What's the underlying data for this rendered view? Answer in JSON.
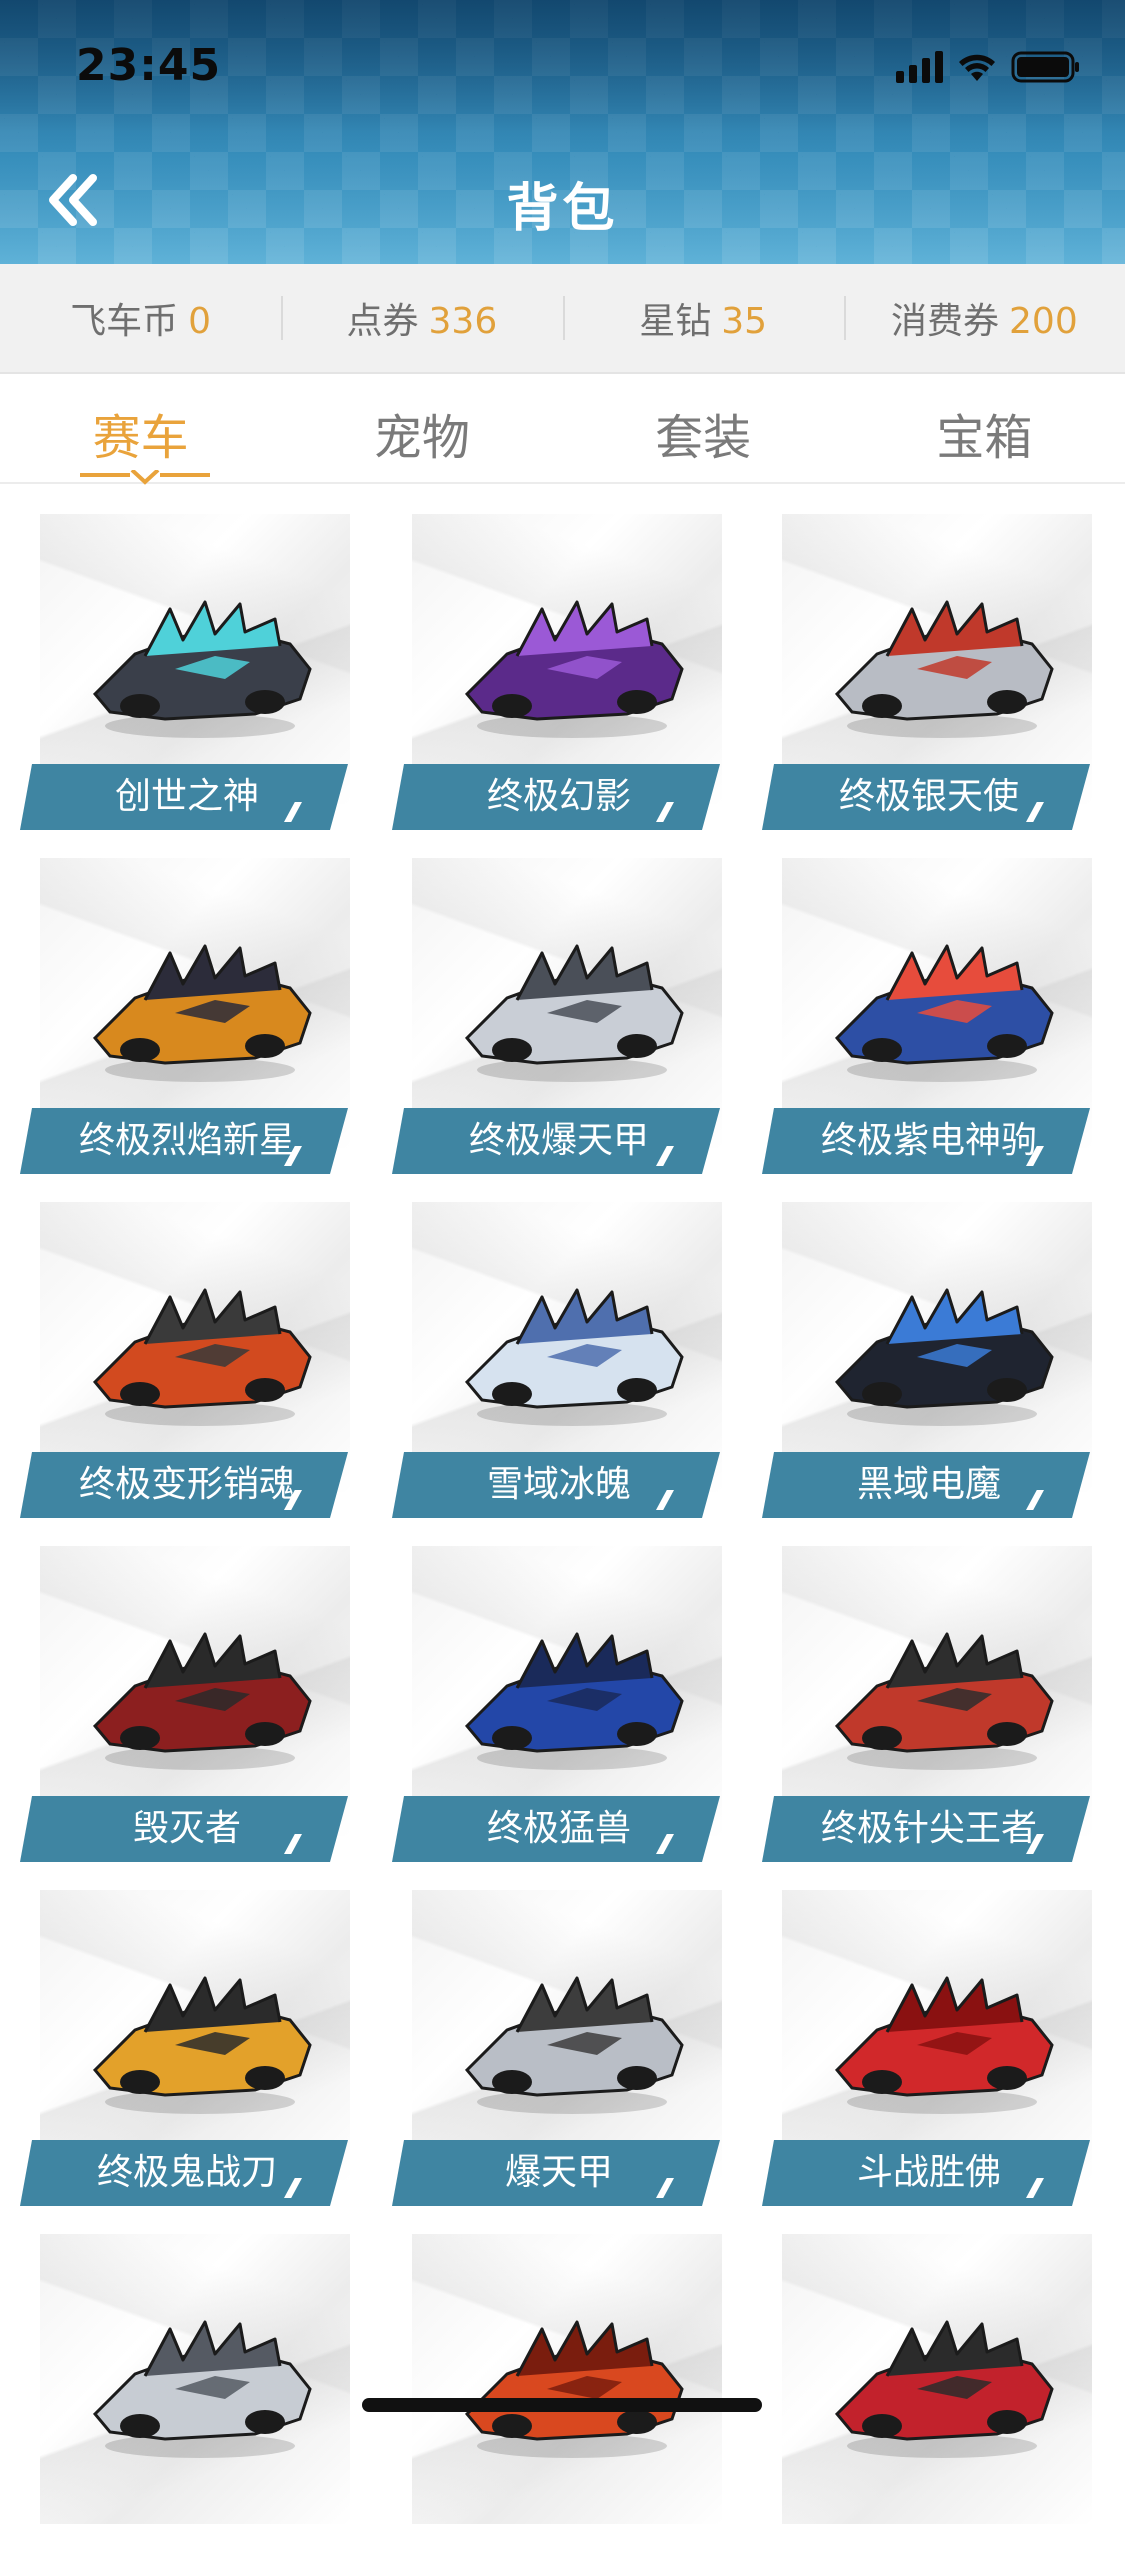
{
  "status_bar": {
    "time": "23:45"
  },
  "header": {
    "title": "背包",
    "back_icon": "double-chevron-left-icon"
  },
  "currencies": [
    {
      "label": "飞车币",
      "value": "0"
    },
    {
      "label": "点券",
      "value": "336"
    },
    {
      "label": "星钻",
      "value": "35"
    },
    {
      "label": "消费券",
      "value": "200"
    }
  ],
  "tabs": [
    {
      "label": "赛车",
      "active": true
    },
    {
      "label": "宠物",
      "active": false
    },
    {
      "label": "套装",
      "active": false
    },
    {
      "label": "宝箱",
      "active": false
    }
  ],
  "colors": {
    "accent": "#e9a33b",
    "label_bg": "#3f85a2",
    "header": "#3b8fb9"
  },
  "items": [
    {
      "name": "创世之神",
      "color": "#3a3f4a",
      "accent": "#4fd1d9"
    },
    {
      "name": "终极幻影",
      "color": "#5b2a8a",
      "accent": "#9b59d6"
    },
    {
      "name": "终极银天使",
      "color": "#b8bcc4",
      "accent": "#c0392b"
    },
    {
      "name": "终极烈焰新星",
      "color": "#d8891e",
      "accent": "#2c2c3a"
    },
    {
      "name": "终极爆天甲",
      "color": "#c9ced6",
      "accent": "#4a4f58"
    },
    {
      "name": "终极紫电神驹",
      "color": "#2d4fa5",
      "accent": "#e74c3c"
    },
    {
      "name": "终极变形销魂",
      "color": "#d24a1f",
      "accent": "#3a3a3a"
    },
    {
      "name": "雪域冰魄",
      "color": "#d6e2ef",
      "accent": "#4f6fae"
    },
    {
      "name": "黑域电魔",
      "color": "#1f2430",
      "accent": "#3b7bd6"
    },
    {
      "name": "毁灭者",
      "color": "#8c1f1f",
      "accent": "#2a2a2a"
    },
    {
      "name": "终极猛兽",
      "color": "#2347a8",
      "accent": "#1a2a5a"
    },
    {
      "name": "终极针尖王者",
      "color": "#c0392b",
      "accent": "#2e2e2e"
    },
    {
      "name": "终极鬼战刀",
      "color": "#e3a12a",
      "accent": "#2b2b2b"
    },
    {
      "name": "爆天甲",
      "color": "#b9bec6",
      "accent": "#3d3d3d"
    },
    {
      "name": "斗战胜佛",
      "color": "#d1282a",
      "accent": "#8a1111"
    },
    {
      "name": "",
      "color": "#c7ccd3",
      "accent": "#555a63"
    },
    {
      "name": "",
      "color": "#d9481f",
      "accent": "#7a1d0e"
    },
    {
      "name": "",
      "color": "#c2222c",
      "accent": "#2b2b2b"
    }
  ]
}
